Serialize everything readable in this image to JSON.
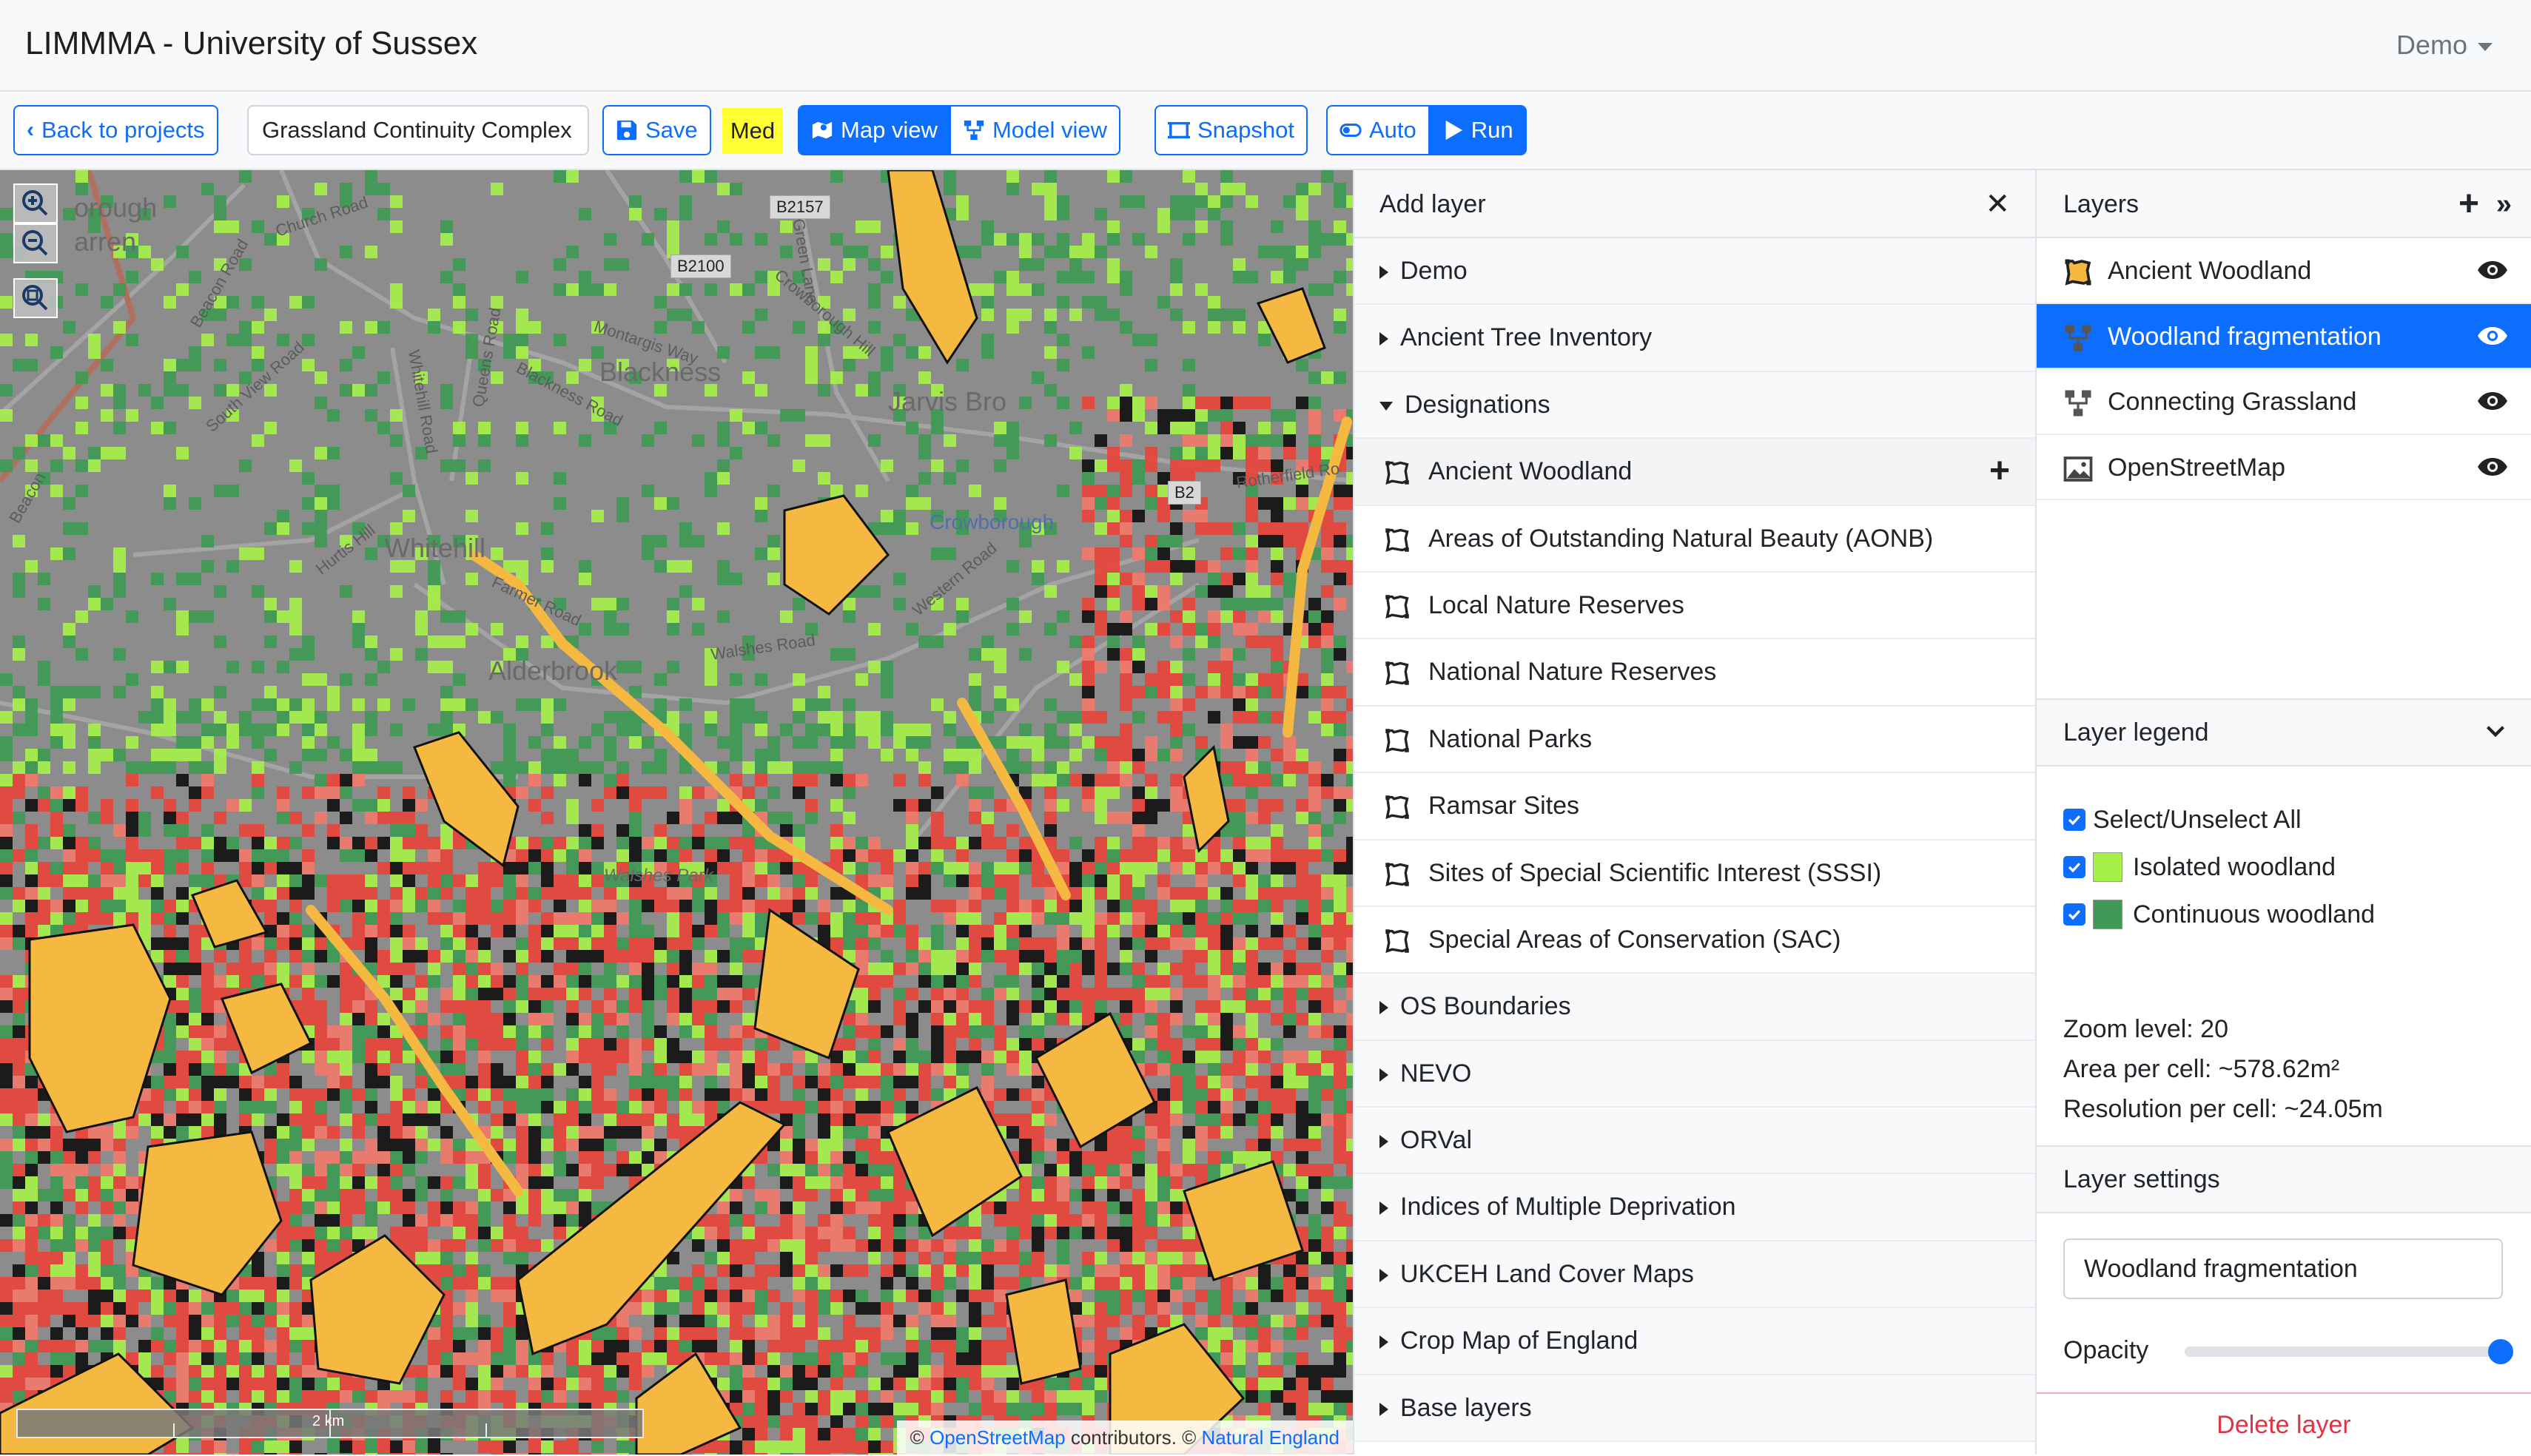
{
  "app": {
    "title": "LIMMMA - University of Sussex",
    "user_menu": "Demo"
  },
  "toolbar": {
    "back_label": "Back to projects",
    "project_name": "Grassland Continuity Complex",
    "save_label": "Save",
    "quality_badge": "Med",
    "map_view_label": "Map view",
    "model_view_label": "Model view",
    "snapshot_label": "Snapshot",
    "auto_label": "Auto",
    "run_label": "Run"
  },
  "map": {
    "labels": {
      "borough": "orough",
      "warren": "arren",
      "blackness": "Blackness",
      "jarvis_brook": "Jarvis Bro",
      "whitehill": "Whitehill",
      "alderbrook": "Alderbrook",
      "crowborough": "Crowborough",
      "walshes_park": "Walshes Park",
      "church_road": "Church Road",
      "beacon_road": "Beacon Road",
      "south_view_road": "South View Road",
      "whitehill_road": "Whitehill Road",
      "queens_road": "Queens Road",
      "montargis_way": "Montargis Way",
      "blackness_road": "Blackness Road",
      "green_lane": "Green Lane",
      "crowborough_hill": "Crowborough Hill",
      "hurtis_hill": "Hurtis Hill",
      "farmers_road": "Farmer Road",
      "walshes_road": "Walshes Road",
      "western_road": "Western Road",
      "rotherfield_road": "Rotherfield Ro",
      "b2157": "B2157",
      "b2100": "B2100",
      "b2": "B2",
      "beacon": "Beacon"
    },
    "scale_label": "2 km",
    "attribution": {
      "prefix": "© ",
      "osm": "OpenStreetMap",
      "middle": " contributors. © ",
      "ne": "Natural England"
    }
  },
  "add_layer": {
    "title": "Add layer",
    "groups": [
      {
        "label": "Demo"
      },
      {
        "label": "Ancient Tree Inventory"
      },
      {
        "label": "Designations"
      },
      {
        "label": "OS Boundaries"
      },
      {
        "label": "NEVO"
      },
      {
        "label": "ORVal"
      },
      {
        "label": "Indices of Multiple Deprivation"
      },
      {
        "label": "UKCEH Land Cover Maps"
      },
      {
        "label": "Crop Map of England"
      },
      {
        "label": "Base layers"
      }
    ],
    "designations": [
      "Ancient Woodland",
      "Areas of Outstanding Natural Beauty (AONB)",
      "Local Nature Reserves",
      "National Nature Reserves",
      "National Parks",
      "Ramsar Sites",
      "Sites of Special Scientific Interest (SSSI)",
      "Special Areas of Conservation (SAC)"
    ]
  },
  "layers": {
    "title": "Layers",
    "items": [
      {
        "label": "Ancient Woodland",
        "icon": "polygon-icon"
      },
      {
        "label": "Woodland fragmentation",
        "icon": "model-icon"
      },
      {
        "label": "Connecting Grassland",
        "icon": "model-icon"
      },
      {
        "label": "OpenStreetMap",
        "icon": "image-icon"
      }
    ]
  },
  "legend": {
    "title": "Layer legend",
    "select_all": "Select/Unselect All",
    "items": [
      {
        "label": "Isolated woodland",
        "color": "#a6f04a"
      },
      {
        "label": "Continuous woodland",
        "color": "#3e9a54"
      }
    ],
    "zoom": "Zoom level: 20",
    "area": "Area per cell: ~578.62m²",
    "resolution": "Resolution per cell: ~24.05m"
  },
  "settings": {
    "title": "Layer settings",
    "layer_name": "Woodland fragmentation",
    "opacity_label": "Opacity",
    "opacity": 1.0,
    "delete_label": "Delete layer"
  },
  "colors": {
    "primary": "#0d6efd",
    "woodland_orange": "#f5b942",
    "isolated_green": "#a6f04a",
    "continuous_green": "#3e9a54",
    "fragment_red": "#e8443a",
    "highlight_yellow": "#ffff33"
  }
}
